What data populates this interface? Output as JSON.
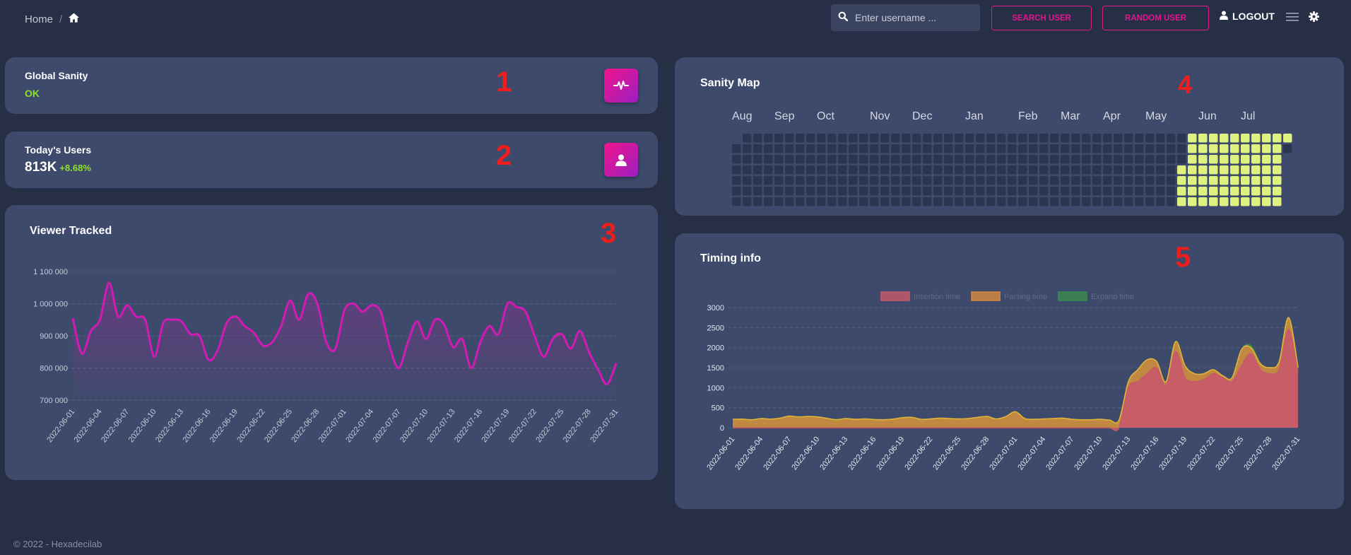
{
  "breadcrumb": {
    "home": "Home",
    "separator": "/"
  },
  "header": {
    "search_placeholder": "Enter username ...",
    "search_button": "SEARCH USER",
    "random_button": "RANDOM USER",
    "logout": "LOGOUT"
  },
  "cards": {
    "sanity": {
      "title": "Global Sanity",
      "status": "OK",
      "marker": "1",
      "icon": "pulse-icon"
    },
    "users": {
      "title": "Today's Users",
      "value": "813K",
      "change": "+8.68%",
      "marker": "2",
      "icon": "user-icon"
    },
    "viewer": {
      "title": "Viewer Tracked",
      "marker": "3"
    },
    "map": {
      "title": "Sanity Map",
      "marker": "4",
      "months": [
        "Aug",
        "Sep",
        "Oct",
        "Nov",
        "Dec",
        "Jan",
        "Feb",
        "Mar",
        "Apr",
        "May",
        "Jun",
        "Jul"
      ]
    },
    "timing": {
      "title": "Timing info",
      "marker": "5"
    }
  },
  "footer": "© 2022 - Hexadecilab",
  "colors": {
    "accent": "#e2178c",
    "ok": "#8ee12a",
    "line": "#d21ab4",
    "cell_on": "#dff27f",
    "cell_off": "#2c3550"
  },
  "chart_data": [
    {
      "type": "line",
      "title": "Viewer Tracked",
      "x": [
        "2022-06-01",
        "2022-06-02",
        "2022-06-03",
        "2022-06-04",
        "2022-06-05",
        "2022-06-06",
        "2022-06-07",
        "2022-06-08",
        "2022-06-09",
        "2022-06-10",
        "2022-06-11",
        "2022-06-12",
        "2022-06-13",
        "2022-06-14",
        "2022-06-15",
        "2022-06-16",
        "2022-06-17",
        "2022-06-18",
        "2022-06-19",
        "2022-06-20",
        "2022-06-21",
        "2022-06-22",
        "2022-06-23",
        "2022-06-24",
        "2022-06-25",
        "2022-06-26",
        "2022-06-27",
        "2022-06-28",
        "2022-06-29",
        "2022-06-30",
        "2022-07-01",
        "2022-07-02",
        "2022-07-03",
        "2022-07-04",
        "2022-07-05",
        "2022-07-06",
        "2022-07-07",
        "2022-07-08",
        "2022-07-09",
        "2022-07-10",
        "2022-07-11",
        "2022-07-12",
        "2022-07-13",
        "2022-07-14",
        "2022-07-15",
        "2022-07-16",
        "2022-07-17",
        "2022-07-18",
        "2022-07-19",
        "2022-07-20",
        "2022-07-21",
        "2022-07-22",
        "2022-07-23",
        "2022-07-24",
        "2022-07-25",
        "2022-07-26",
        "2022-07-27",
        "2022-07-28",
        "2022-07-29",
        "2022-07-30",
        "2022-07-31"
      ],
      "x_tick_labels": [
        "2022-06-01",
        "2022-06-04",
        "2022-06-07",
        "2022-06-10",
        "2022-06-13",
        "2022-06-16",
        "2022-06-19",
        "2022-06-22",
        "2022-06-25",
        "2022-06-28",
        "2022-07-01",
        "2022-07-04",
        "2022-07-07",
        "2022-07-10",
        "2022-07-13",
        "2022-07-16",
        "2022-07-19",
        "2022-07-22",
        "2022-07-25",
        "2022-07-28",
        "2022-07-31"
      ],
      "y_tick_labels": [
        "700 000",
        "800 000",
        "900 000",
        "1 000 000",
        "1 100 000"
      ],
      "ylim": [
        700000,
        1100000
      ],
      "series": [
        {
          "values": [
            955000,
            845000,
            915000,
            950000,
            1065000,
            960000,
            995000,
            960000,
            950000,
            835000,
            940000,
            950000,
            945000,
            905000,
            900000,
            825000,
            855000,
            940000,
            960000,
            930000,
            910000,
            870000,
            880000,
            930000,
            1010000,
            950000,
            1030000,
            1000000,
            880000,
            860000,
            980000,
            1000000,
            975000,
            995000,
            975000,
            865000,
            800000,
            880000,
            945000,
            890000,
            950000,
            935000,
            865000,
            890000,
            800000,
            880000,
            930000,
            905000,
            1000000,
            990000,
            975000,
            900000,
            835000,
            890000,
            905000,
            860000,
            915000,
            850000,
            795000,
            750000,
            815000
          ]
        }
      ],
      "grid": true
    },
    {
      "type": "heatmap",
      "title": "Sanity Map",
      "columns_labels": [
        "Aug",
        "Sep",
        "Oct",
        "Nov",
        "Dec",
        "Jan",
        "Feb",
        "Mar",
        "Apr",
        "May",
        "Jun",
        "Jul"
      ],
      "rows": 7,
      "weeks": 53,
      "active_from_week": 43,
      "active_to_week": 52,
      "notes": "cells before June 2022 inactive (dark), June-July 2022 active (yellow-green)"
    },
    {
      "type": "area",
      "title": "Timing info",
      "legend": [
        "Insertion time",
        "Parsing time",
        "Expand time"
      ],
      "legend_position": "top",
      "x_tick_labels": [
        "2022-06-01",
        "2022-06-04",
        "2022-06-07",
        "2022-06-10",
        "2022-06-13",
        "2022-06-16",
        "2022-06-19",
        "2022-06-22",
        "2022-06-25",
        "2022-06-28",
        "2022-07-01",
        "2022-07-04",
        "2022-07-07",
        "2022-07-10",
        "2022-07-13",
        "2022-07-16",
        "2022-07-19",
        "2022-07-22",
        "2022-07-25",
        "2022-07-28",
        "2022-07-31"
      ],
      "y_tick_labels": [
        "0",
        "500",
        "1000",
        "1500",
        "2000",
        "2500",
        "3000"
      ],
      "ylim": [
        0,
        3000
      ],
      "series": [
        {
          "name": "Insertion time",
          "color": "#c8596b",
          "values": [
            0,
            0,
            0,
            0,
            0,
            0,
            0,
            0,
            0,
            0,
            0,
            0,
            0,
            0,
            0,
            0,
            0,
            0,
            0,
            0,
            0,
            0,
            0,
            0,
            0,
            0,
            0,
            0,
            0,
            0,
            0,
            0,
            0,
            0,
            0,
            0,
            0,
            0,
            0,
            0,
            0,
            0,
            1000,
            1150,
            1350,
            1500,
            1050,
            1900,
            1250,
            1150,
            1200,
            1350,
            1250,
            1150,
            1550,
            1850,
            1450,
            1350,
            1450,
            2450,
            1350
          ]
        },
        {
          "name": "Parsing time",
          "color": "#d98a3f",
          "values": [
            210,
            215,
            200,
            230,
            215,
            240,
            290,
            270,
            280,
            270,
            235,
            200,
            230,
            210,
            220,
            205,
            200,
            215,
            250,
            260,
            210,
            220,
            240,
            230,
            220,
            230,
            260,
            280,
            220,
            280,
            400,
            230,
            210,
            220,
            230,
            240,
            210,
            200,
            200,
            210,
            190,
            190,
            1150,
            1450,
            1700,
            1650,
            1150,
            2150,
            1550,
            1350,
            1350,
            1450,
            1300,
            1250,
            1950,
            2000,
            1600,
            1500,
            1650,
            2750,
            1500
          ]
        },
        {
          "name": "Expand time",
          "color": "#3a8a4e",
          "values": [
            210,
            215,
            200,
            230,
            215,
            240,
            290,
            270,
            280,
            270,
            235,
            200,
            230,
            210,
            220,
            205,
            200,
            215,
            250,
            260,
            210,
            220,
            240,
            230,
            220,
            230,
            260,
            280,
            220,
            280,
            400,
            230,
            210,
            220,
            230,
            240,
            210,
            200,
            200,
            210,
            190,
            190,
            1150,
            1450,
            1700,
            1650,
            1150,
            2150,
            1550,
            1350,
            1350,
            1450,
            1300,
            1250,
            1950,
            2050,
            1600,
            1500,
            1650,
            2750,
            1500
          ]
        }
      ],
      "grid": true
    }
  ]
}
